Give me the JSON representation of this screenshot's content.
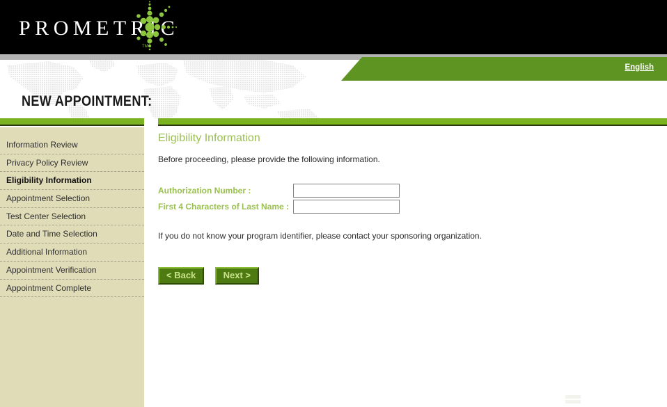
{
  "brand": {
    "wordmark": "PROMETRIC",
    "trademark": "TM",
    "logo_color": "#8cc63e",
    "bar_color": "#000000"
  },
  "header": {
    "language_link": "English",
    "banner_color": "#5e9421",
    "page_title": "NEW APPOINTMENT:",
    "rule_color": "#7ab31f"
  },
  "sidebar": {
    "background": "#e0dcb8",
    "items": [
      {
        "label": "Information Review",
        "active": false
      },
      {
        "label": "Privacy Policy Review",
        "active": false
      },
      {
        "label": "Eligibility Information",
        "active": true
      },
      {
        "label": "Appointment Selection",
        "active": false
      },
      {
        "label": "Test Center Selection",
        "active": false
      },
      {
        "label": "Date and Time Selection",
        "active": false
      },
      {
        "label": "Additional Information",
        "active": false
      },
      {
        "label": "Appointment Verification",
        "active": false
      },
      {
        "label": "Appointment Complete",
        "active": false
      }
    ]
  },
  "main": {
    "heading": "Eligibility Information",
    "heading_color": "#9ac04f",
    "intro": "Before proceeding, please provide the following information.",
    "fields": [
      {
        "label": "Authorization Number :",
        "value": "",
        "placeholder": ""
      },
      {
        "label": "First 4 Characters of Last Name :",
        "value": "",
        "placeholder": ""
      }
    ],
    "note": "If you do not know your program identifier, please contact your sponsoring organization.",
    "buttons": [
      {
        "label": "< Back"
      },
      {
        "label": "Next >"
      }
    ]
  }
}
